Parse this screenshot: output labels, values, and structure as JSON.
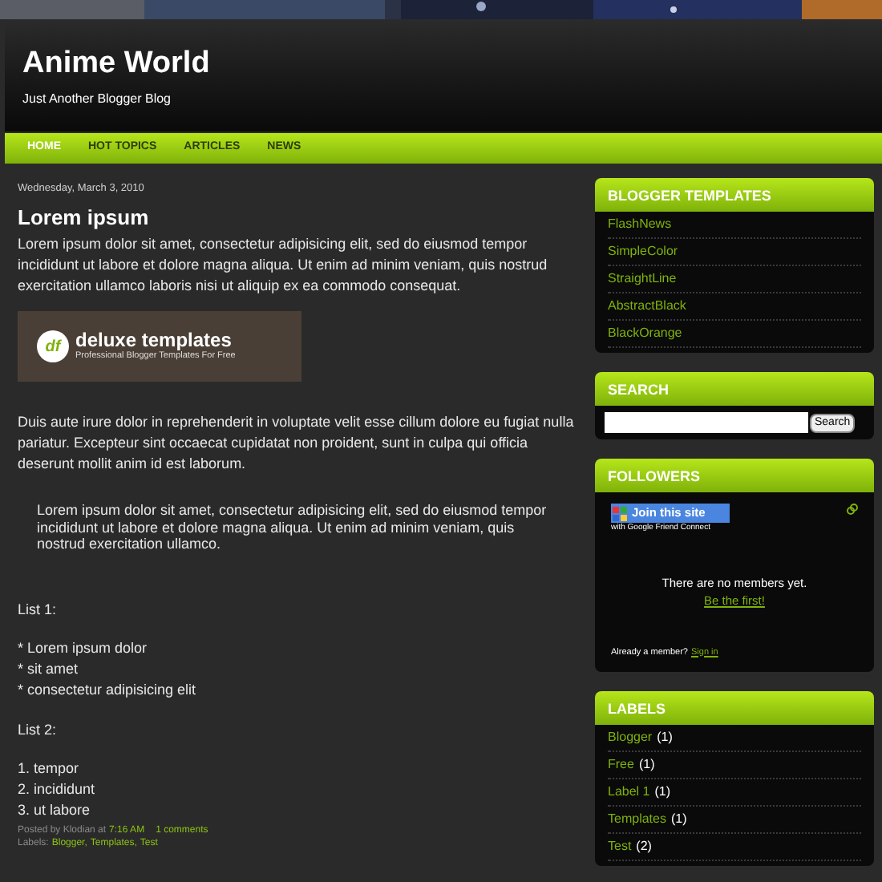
{
  "header": {
    "title": "Anime World",
    "tagline": "Just Another Blogger Blog"
  },
  "nav": [
    {
      "label": "HOME",
      "selected": true
    },
    {
      "label": "HOT TOPICS",
      "selected": false
    },
    {
      "label": "ARTICLES",
      "selected": false
    },
    {
      "label": "NEWS",
      "selected": false
    }
  ],
  "post": {
    "date": "Wednesday, March 3, 2010",
    "title": "Lorem ipsum",
    "intro": "Lorem ipsum dolor sit amet, consectetur adipisicing elit, sed do eiusmod tempor incididunt ut labore et dolore magna aliqua. Ut enim ad minim veniam, quis nostrud exercitation ullamco laboris nisi ut aliquip ex ea commodo consequat.",
    "banner": {
      "logo": "df",
      "name": "deluxe templates",
      "slogan": "Professional Blogger Templates For Free"
    },
    "paragraph": "Duis aute irure dolor in reprehenderit in voluptate velit esse cillum dolore eu fugiat nulla pariatur. Excepteur sint occaecat cupidatat non proident, sunt in culpa qui officia deserunt mollit anim id est laborum.",
    "quote": "Lorem ipsum dolor sit amet, consectetur adipisicing elit, sed do eiusmod tempor incididunt ut labore et dolore magna aliqua. Ut enim ad minim veniam, quis nostrud exercitation ullamco.",
    "list1_title": "List 1:",
    "list1": [
      "* Lorem ipsum dolor",
      "* sit amet",
      "* consectetur adipisicing elit"
    ],
    "list2_title": "List 2:",
    "list2": [
      "1. tempor",
      "2. incididunt",
      "3. ut labore"
    ],
    "footer": {
      "posted_by": "Posted by Klodian at",
      "time": "7:16 AM",
      "comments": "1 comments",
      "labels_prefix": "Labels:",
      "labels": [
        "Blogger,",
        "Templates,",
        "Test"
      ]
    }
  },
  "sidebar": {
    "templates": {
      "title": "BLOGGER TEMPLATES",
      "items": [
        "FlashNews",
        "SimpleColor",
        "StraightLine",
        "AbstractBlack",
        "BlackOrange"
      ]
    },
    "search": {
      "title": "SEARCH",
      "button": "Search"
    },
    "followers": {
      "title": "FOLLOWERS",
      "join": "Join this site",
      "join_sub": "with Google Friend Connect",
      "empty": "There are no members yet.",
      "be_first": "Be the first!",
      "already": "Already a member?",
      "sign_in": "Sign in"
    },
    "labels": {
      "title": "LABELS",
      "items": [
        {
          "name": "Blogger",
          "count": "(1)"
        },
        {
          "name": "Free",
          "count": "(1)"
        },
        {
          "name": "Label 1",
          "count": "(1)"
        },
        {
          "name": "Templates",
          "count": "(1)"
        },
        {
          "name": "Test",
          "count": "(2)"
        }
      ]
    }
  }
}
